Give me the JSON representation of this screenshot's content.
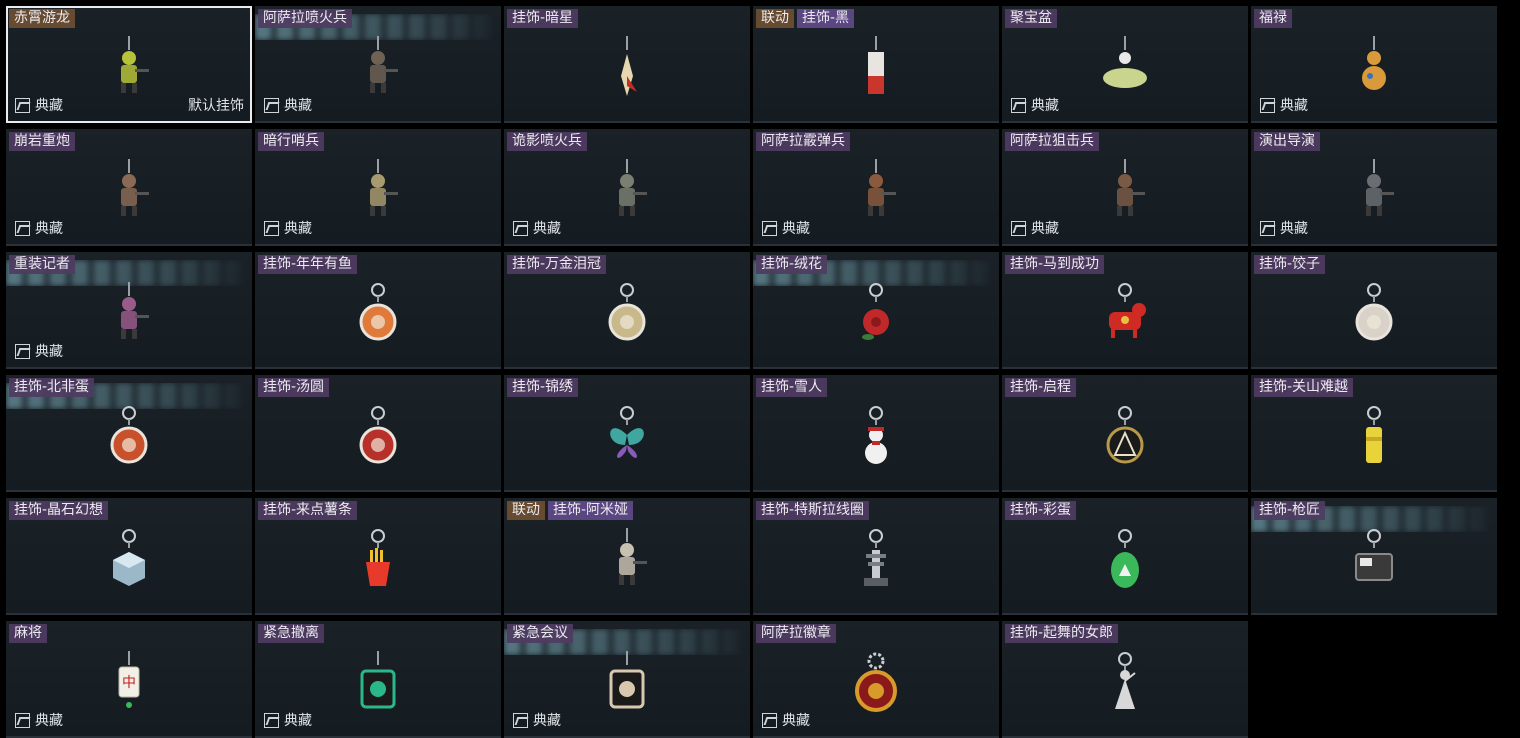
{
  "items": [
    {
      "title": "赤霄游龙",
      "collection": "典藏",
      "default": "默认挂饰",
      "icon": "dragon-figure-charm",
      "color": "#b6c23a",
      "kind": "figure",
      "selected": true
    },
    {
      "title": "阿萨拉喷火兵",
      "collection": "典藏",
      "icon": "flamethrower-soldier-charm",
      "color": "#6f6255",
      "kind": "figure",
      "glare": true
    },
    {
      "title": "挂饰-暗星",
      "icon": "dark-star-charm",
      "color": "#e6d7b0",
      "kind": "star"
    },
    {
      "title": "挂饰-黑",
      "tag": "联动",
      "icon": "black-card-charm",
      "color": "#c9362e",
      "kind": "card"
    },
    {
      "title": "聚宝盆",
      "collection": "典藏",
      "icon": "treasure-bowl-charm",
      "color": "#c9d58f",
      "kind": "bowl"
    },
    {
      "title": "福禄",
      "collection": "典藏",
      "icon": "gourd-charm",
      "color": "#d89a3a",
      "kind": "gourd"
    },
    {
      "title": "崩岩重炮",
      "collection": "典藏",
      "icon": "heavy-gunner-charm",
      "color": "#8a6a55",
      "kind": "figure"
    },
    {
      "title": "暗行哨兵",
      "collection": "典藏",
      "icon": "sentry-charm",
      "color": "#a89a6f",
      "kind": "figure"
    },
    {
      "title": "诡影喷火兵",
      "collection": "典藏",
      "icon": "shadow-flamethrower-charm",
      "color": "#7a7f72",
      "kind": "figure"
    },
    {
      "title": "阿萨拉霰弹兵",
      "collection": "典藏",
      "icon": "shotgunner-charm",
      "color": "#8a5a3e",
      "kind": "figure"
    },
    {
      "title": "阿萨拉狙击兵",
      "collection": "典藏",
      "icon": "sniper-charm",
      "color": "#7a5a45",
      "kind": "figure"
    },
    {
      "title": "演出导演",
      "collection": "典藏",
      "icon": "director-charm",
      "color": "#6a6e72",
      "kind": "figure"
    },
    {
      "title": "重装记者",
      "collection": "典藏",
      "icon": "armored-reporter-charm",
      "color": "#9a5a8a",
      "kind": "figure",
      "glare": true
    },
    {
      "title": "挂饰-年年有鱼",
      "icon": "fish-plate-charm",
      "color": "#e07a3a",
      "kind": "round"
    },
    {
      "title": "挂饰-万金泪冠",
      "icon": "golden-crown-charm",
      "color": "#c8b88a",
      "kind": "round"
    },
    {
      "title": "挂饰-绒花",
      "icon": "velvet-flower-charm",
      "color": "#c0282a",
      "kind": "flower",
      "glare": true
    },
    {
      "title": "挂饰-马到成功",
      "icon": "red-horse-charm",
      "color": "#d02a24",
      "kind": "horse"
    },
    {
      "title": "挂饰-饺子",
      "icon": "dumpling-plate-charm",
      "color": "#d8d2c8",
      "kind": "round"
    },
    {
      "title": "挂饰-北非蛋",
      "icon": "shakshuka-charm",
      "color": "#c8502a",
      "kind": "round",
      "glare": true
    },
    {
      "title": "挂饰-汤圆",
      "icon": "tangyuan-bowl-charm",
      "color": "#b8302a",
      "kind": "round"
    },
    {
      "title": "挂饰-锦绣",
      "icon": "butterfly-charm",
      "color": "#3fa6a0",
      "kind": "butterfly"
    },
    {
      "title": "挂饰-雪人",
      "icon": "snowman-charm",
      "color": "#f0f0f0",
      "kind": "snowman"
    },
    {
      "title": "挂饰-启程",
      "icon": "compass-triangle-charm",
      "color": "#b89a4a",
      "kind": "ring"
    },
    {
      "title": "挂饰-关山难越",
      "icon": "yellow-can-charm",
      "color": "#e8d43a",
      "kind": "can"
    },
    {
      "title": "挂饰-晶石幻想",
      "icon": "crystal-cube-charm",
      "color": "#9ab8c8",
      "kind": "cube"
    },
    {
      "title": "挂饰-来点薯条",
      "icon": "french-fries-charm",
      "color": "#e83a2a",
      "kind": "fries"
    },
    {
      "title": "挂饰-阿米娅",
      "tag": "联动",
      "icon": "amiya-figure-charm",
      "color": "#c8c0b0",
      "kind": "figure"
    },
    {
      "title": "挂饰-特斯拉线圈",
      "icon": "tesla-coil-charm",
      "color": "#c8ccd0",
      "kind": "coil"
    },
    {
      "title": "挂饰-彩蛋",
      "icon": "green-egg-charm",
      "color": "#3ab85a",
      "kind": "egg"
    },
    {
      "title": "挂饰-枪匠",
      "icon": "gunsmith-box-charm",
      "color": "#8a8a8a",
      "kind": "box",
      "glare": true
    },
    {
      "title": "麻将",
      "collection": "典藏",
      "icon": "mahjong-tile-charm",
      "color": "#f2efe6",
      "kind": "tile"
    },
    {
      "title": "紧急撤离",
      "collection": "典藏",
      "icon": "evac-card-charm",
      "color": "#2ab88a",
      "kind": "square"
    },
    {
      "title": "紧急会议",
      "collection": "典藏",
      "icon": "meeting-poster-charm",
      "color": "#d8c8b0",
      "kind": "square",
      "glare": true
    },
    {
      "title": "阿萨拉徽章",
      "collection": "典藏",
      "icon": "asala-badge-charm",
      "color": "#d89a2a",
      "kind": "badge"
    },
    {
      "title": "挂饰-起舞的女郎",
      "icon": "dancing-lady-charm",
      "color": "#d8d8d8",
      "kind": "lady"
    }
  ]
}
